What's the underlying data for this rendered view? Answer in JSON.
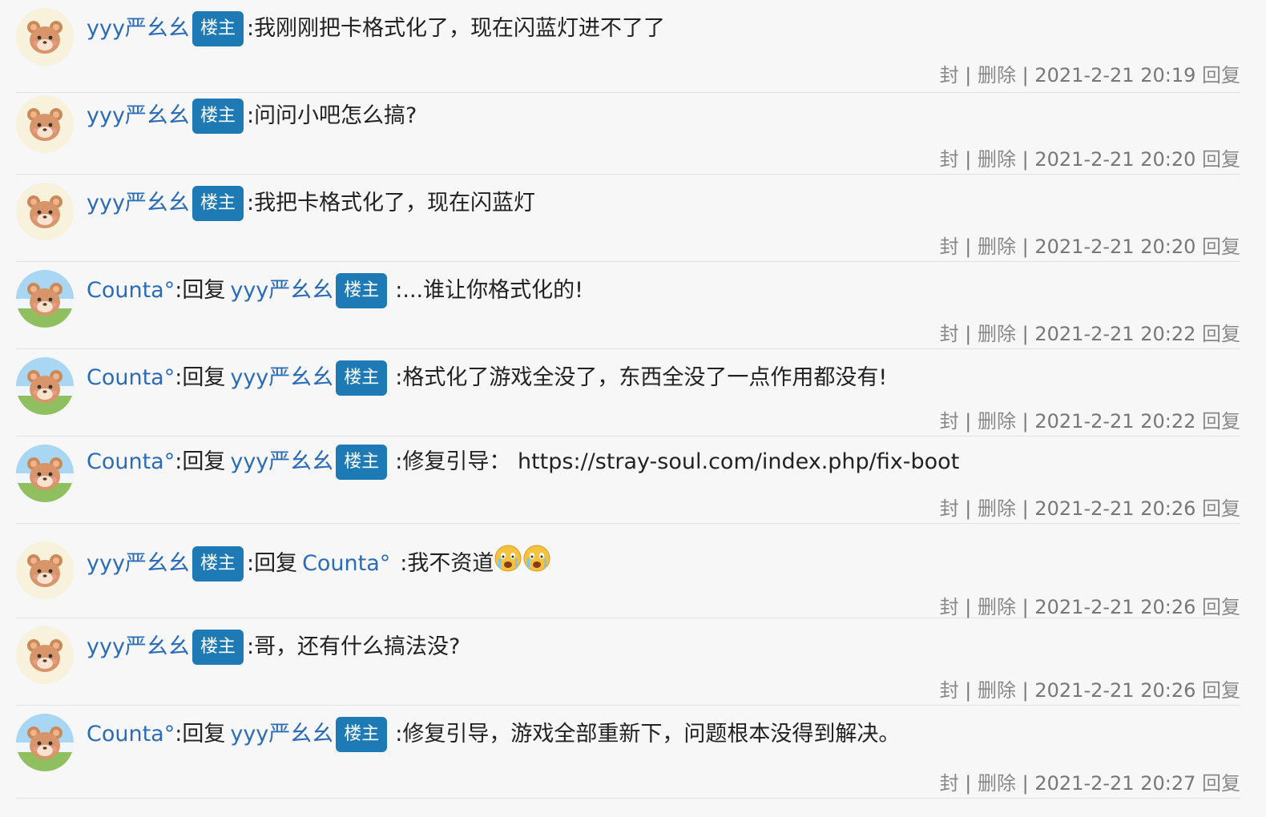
{
  "meta_labels": {
    "ban": "封",
    "delete": "删除",
    "reply": "回复",
    "sep": "|"
  },
  "badge_label": "楼主",
  "reply_word": "回复",
  "replies": [
    {
      "avatar": "bear",
      "user": "yyy严幺幺",
      "owner": true,
      "target": null,
      "target_owner": false,
      "text": "我刚刚把卡格式化了，现在闪蓝灯进不了了",
      "emoji": 0,
      "time": "2021-2-21 20:19"
    },
    {
      "avatar": "bear",
      "user": "yyy严幺幺",
      "owner": true,
      "target": null,
      "target_owner": false,
      "text": "问问小吧怎么搞?",
      "emoji": 0,
      "time": "2021-2-21 20:20"
    },
    {
      "avatar": "bear",
      "user": "yyy严幺幺",
      "owner": true,
      "target": null,
      "target_owner": false,
      "text": "我把卡格式化了，现在闪蓝灯",
      "emoji": 0,
      "time": "2021-2-21 20:20"
    },
    {
      "avatar": "sky",
      "user": "Counta°",
      "owner": false,
      "target": "yyy严幺幺",
      "target_owner": true,
      "text": ":...谁让你格式化的!",
      "emoji": 0,
      "time": "2021-2-21 20:22"
    },
    {
      "avatar": "sky",
      "user": "Counta°",
      "owner": false,
      "target": "yyy严幺幺",
      "target_owner": true,
      "text": ":格式化了游戏全没了，东西全没了一点作用都没有!",
      "emoji": 0,
      "time": "2021-2-21 20:22"
    },
    {
      "avatar": "sky",
      "user": "Counta°",
      "owner": false,
      "target": "yyy严幺幺",
      "target_owner": true,
      "text": ":修复引导： https://stray-soul.com/index.php/fix-boot",
      "emoji": 0,
      "time": "2021-2-21 20:26"
    },
    {
      "avatar": "bear",
      "user": "yyy严幺幺",
      "owner": true,
      "target": "Counta°",
      "target_owner": false,
      "text": ":我不资道",
      "emoji": 2,
      "time": "2021-2-21 20:26"
    },
    {
      "avatar": "bear",
      "user": "yyy严幺幺",
      "owner": true,
      "target": null,
      "target_owner": false,
      "text": "哥，还有什么搞法没?",
      "emoji": 0,
      "time": "2021-2-21 20:26"
    },
    {
      "avatar": "sky",
      "user": "Counta°",
      "owner": false,
      "target": "yyy严幺幺",
      "target_owner": true,
      "text": ":修复引导，游戏全部重新下，问题根本没得到解决。",
      "emoji": 0,
      "time": "2021-2-21 20:27"
    }
  ]
}
